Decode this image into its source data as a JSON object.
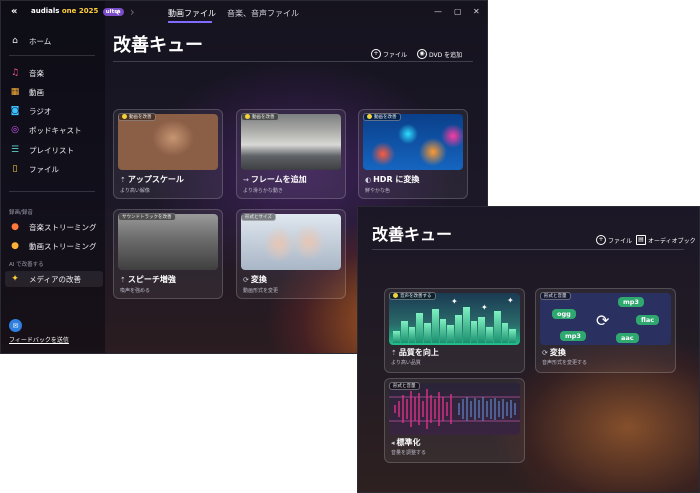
{
  "main_window": {
    "logo": {
      "brand": "audials",
      "edition": "one 2025",
      "badge": "ultra"
    },
    "nav": [
      {
        "label": "ホーム",
        "icon": "home-icon",
        "glyph": "⌂"
      },
      {
        "label": "音楽",
        "icon": "music-note-icon",
        "glyph": "♫"
      },
      {
        "label": "動画",
        "icon": "film-icon",
        "glyph": "▦"
      },
      {
        "label": "ラジオ",
        "icon": "radio-icon",
        "glyph": "◙"
      },
      {
        "label": "ポッドキャスト",
        "icon": "podcast-icon",
        "glyph": "◎"
      },
      {
        "label": "プレイリスト",
        "icon": "playlist-icon",
        "glyph": "☰"
      },
      {
        "label": "ファイル",
        "icon": "file-icon",
        "glyph": "▯"
      }
    ],
    "section_recording": "録画/録音",
    "nav2": [
      {
        "label": "音楽ストリーミング",
        "icon": "music-stream-icon",
        "glyph": "●"
      },
      {
        "label": "動画ストリーミング",
        "icon": "video-stream-icon",
        "glyph": "●"
      }
    ],
    "section_ai": "AI で改善する",
    "nav_active": {
      "label": "メディアの改善",
      "icon": "sparkle-icon",
      "glyph": "✦"
    },
    "feedback": {
      "label": "フィードバックを送信",
      "icon": "feedback-icon"
    },
    "tabs": [
      {
        "label": "動画ファイル",
        "active": true
      },
      {
        "label": "音楽、音声ファイル",
        "active": false
      }
    ],
    "title": "改善キュー",
    "header_buttons": [
      {
        "label": "ファイル",
        "icon": "plus-circle-icon",
        "glyph": "+"
      },
      {
        "label": "DVD を追加",
        "icon": "disc-icon",
        "glyph": "◉"
      }
    ],
    "cards": [
      {
        "chip": "動画を改善",
        "title": "アップスケール",
        "sub": "より高い解像",
        "icon": "upscale-icon",
        "glyph": "⇡"
      },
      {
        "chip": "動画を改善",
        "title": "フレームを追加",
        "sub": "より滑らかな動き",
        "icon": "frames-icon",
        "glyph": "⇝"
      },
      {
        "chip": "動画を改善",
        "title": "HDR に変換",
        "sub": "鮮やかな色",
        "icon": "palette-icon",
        "glyph": "◐"
      },
      {
        "chip": "サウンドトラックを改善",
        "title": "スピーチ増強",
        "sub": "喚声を強める",
        "icon": "speech-icon",
        "glyph": "⇡"
      },
      {
        "chip": "形式とサイズ",
        "title": "変換",
        "sub": "動画形式を変更",
        "icon": "convert-icon",
        "glyph": "⟳"
      }
    ]
  },
  "audio_window": {
    "title": "改善キュー",
    "header_buttons": [
      {
        "label": "ファイル",
        "icon": "plus-circle-icon",
        "glyph": "+"
      },
      {
        "label": "オーディオブック",
        "icon": "book-icon",
        "glyph": "▤"
      }
    ],
    "cards": [
      {
        "chip": "音声を改善する",
        "title": "品質を向上",
        "sub": "より高い品質",
        "icon": "quality-icon",
        "glyph": "⇡"
      },
      {
        "chip": "形式と音量",
        "title": "変換",
        "sub": "音声形式を変更する",
        "icon": "convert-icon",
        "glyph": "⟳"
      },
      {
        "chip": "形式と音量",
        "title": "標準化",
        "sub": "音量を調整する",
        "icon": "volume-icon",
        "glyph": "◂"
      }
    ],
    "formats": [
      "ogg",
      "mp3",
      "flac",
      "mp3",
      "aac"
    ]
  },
  "colors": {
    "accent": "#7f6cff",
    "brand_yellow": "#ffcf3a",
    "badge": "#7a4cc8",
    "format_chip": "#2fa870"
  }
}
